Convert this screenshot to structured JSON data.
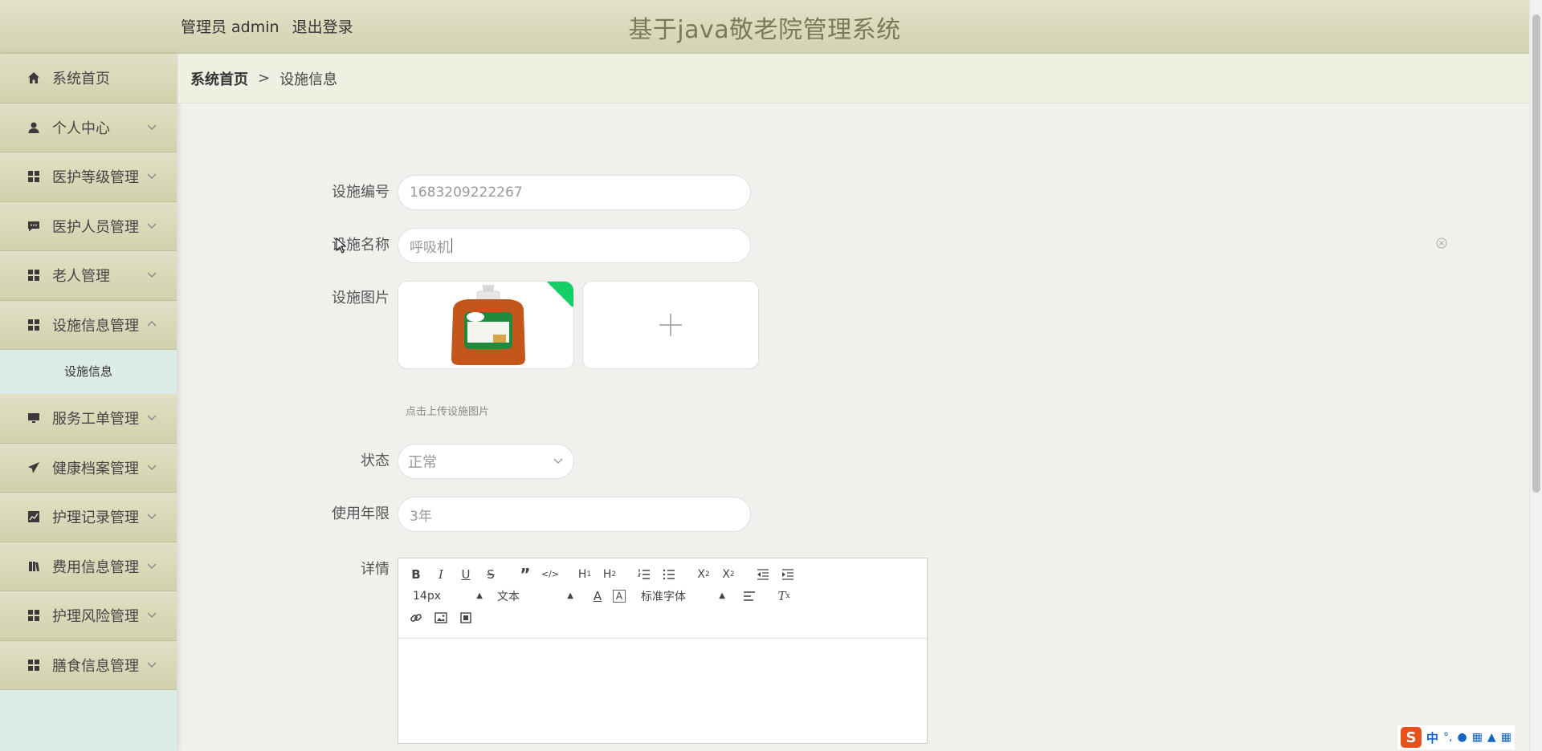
{
  "header": {
    "user_label": "管理员 admin",
    "logout": "退出登录",
    "title": "基于java敬老院管理系统"
  },
  "sidebar": {
    "items": [
      {
        "label": "系统首页",
        "icon": "home-icon"
      },
      {
        "label": "个人中心",
        "icon": "user-icon"
      },
      {
        "label": "医护等级管理",
        "icon": "grid-icon"
      },
      {
        "label": "医护人员管理",
        "icon": "chat-icon"
      },
      {
        "label": "老人管理",
        "icon": "grid-icon"
      },
      {
        "label": "设施信息管理",
        "icon": "grid-icon"
      },
      {
        "label": "服务工单管理",
        "icon": "monitor-icon"
      },
      {
        "label": "健康档案管理",
        "icon": "send-icon"
      },
      {
        "label": "护理记录管理",
        "icon": "chart-icon"
      },
      {
        "label": "费用信息管理",
        "icon": "book-icon"
      },
      {
        "label": "护理风险管理",
        "icon": "grid-icon"
      },
      {
        "label": "膳食信息管理",
        "icon": "grid-icon"
      }
    ],
    "submenu": {
      "label": "设施信息"
    }
  },
  "breadcrumb": {
    "home": "系统首页",
    "separator": ">",
    "current": "设施信息"
  },
  "form": {
    "code": {
      "label": "设施编号",
      "placeholder": "1683209222267"
    },
    "name": {
      "label": "设施名称",
      "value": "呼吸机"
    },
    "image": {
      "label": "设施图片",
      "tip": "点击上传设施图片"
    },
    "status": {
      "label": "状态",
      "value": "正常"
    },
    "years": {
      "label": "使用年限",
      "placeholder": "3年"
    },
    "detail": {
      "label": "详情"
    }
  },
  "editor": {
    "font_size": "14px",
    "heading": "文本",
    "font_family": "标准字体"
  },
  "ime": {
    "label": "中"
  }
}
